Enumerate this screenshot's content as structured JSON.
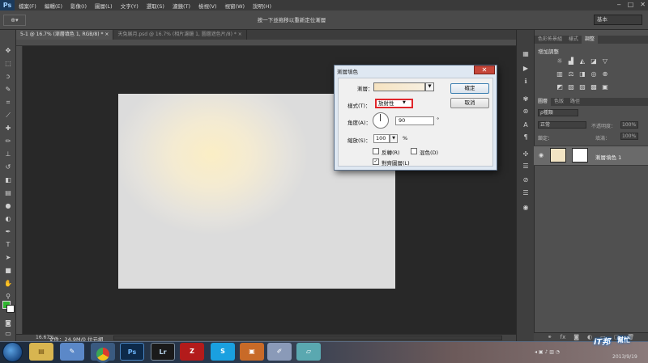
{
  "app": {
    "logo": "Ps"
  },
  "menu": [
    "檔案(F)",
    "編輯(E)",
    "影像(I)",
    "圖層(L)",
    "文字(Y)",
    "選取(S)",
    "濾鏡(T)",
    "檢視(V)",
    "視窗(W)",
    "說明(H)"
  ],
  "window_controls": [
    "‒",
    "□",
    "✕"
  ],
  "options_bar": {
    "tool_preset": "⊕▾",
    "hint": "按一下並拖移以重新定位漸層",
    "workspace": "基本"
  },
  "doc_tabs": [
    {
      "label": "5-1 @ 16.7% (漸層填色 1, RGB/8) *",
      "active": true,
      "close": "×"
    },
    {
      "label": "天兔展月.psd @ 16.7% (相片濾鏡 1, 圖層遮色片/8) *",
      "active": false,
      "close": "×"
    }
  ],
  "status_bar": {
    "zoom": "16.67%",
    "doc_info": "文件：24.9M/0 位元組"
  },
  "panels": {
    "top_tabs": [
      "色彩佈景組",
      "樣式",
      "調整"
    ],
    "adjustments_title": "增加調整",
    "layers_tabs": [
      "圖層",
      "色版",
      "路徑"
    ],
    "layer_filter": "ρ種類",
    "blend_mode": "正常",
    "opacity_label": "不透明度：",
    "opacity_value": "100%",
    "lock_label": "鎖定：",
    "fill_label": "填滿：",
    "fill_value": "100%",
    "layers": [
      {
        "name": "漸層填色 1",
        "visible": true,
        "fill_color": "#f2e4c4"
      }
    ]
  },
  "dialog": {
    "title": "漸層填色",
    "close": "✕",
    "gradient_label": "漸層：",
    "gradient_colors": [
      "#f6e3c1",
      "#f7efdf"
    ],
    "style_label": "樣式(T)：",
    "style_value": "放射性",
    "angle_label": "角度(A)：",
    "angle_value": "90",
    "angle_unit": "°",
    "scale_label": "縮放(S)：",
    "scale_value": "100",
    "scale_unit": "%",
    "reverse_label": "反轉(R)",
    "reverse_checked": false,
    "dither_label": "混色(D)",
    "dither_checked": false,
    "align_label": "對齊圖層(L)",
    "align_checked": true,
    "ok_label": "確定",
    "cancel_label": "取消"
  },
  "taskbar": {
    "apps": [
      "folder",
      "paint",
      "chrome",
      "Ps",
      "Lr",
      "filezilla",
      "skype",
      "toolbox",
      "brush",
      "notes"
    ],
    "date": "2013/9/19"
  },
  "watermark": {
    "logo": "iT邦",
    "sub": "幫忙"
  },
  "colors": {
    "highlight": "#e0262b",
    "foreground": "#2fb52f",
    "background": "#ffffff"
  }
}
